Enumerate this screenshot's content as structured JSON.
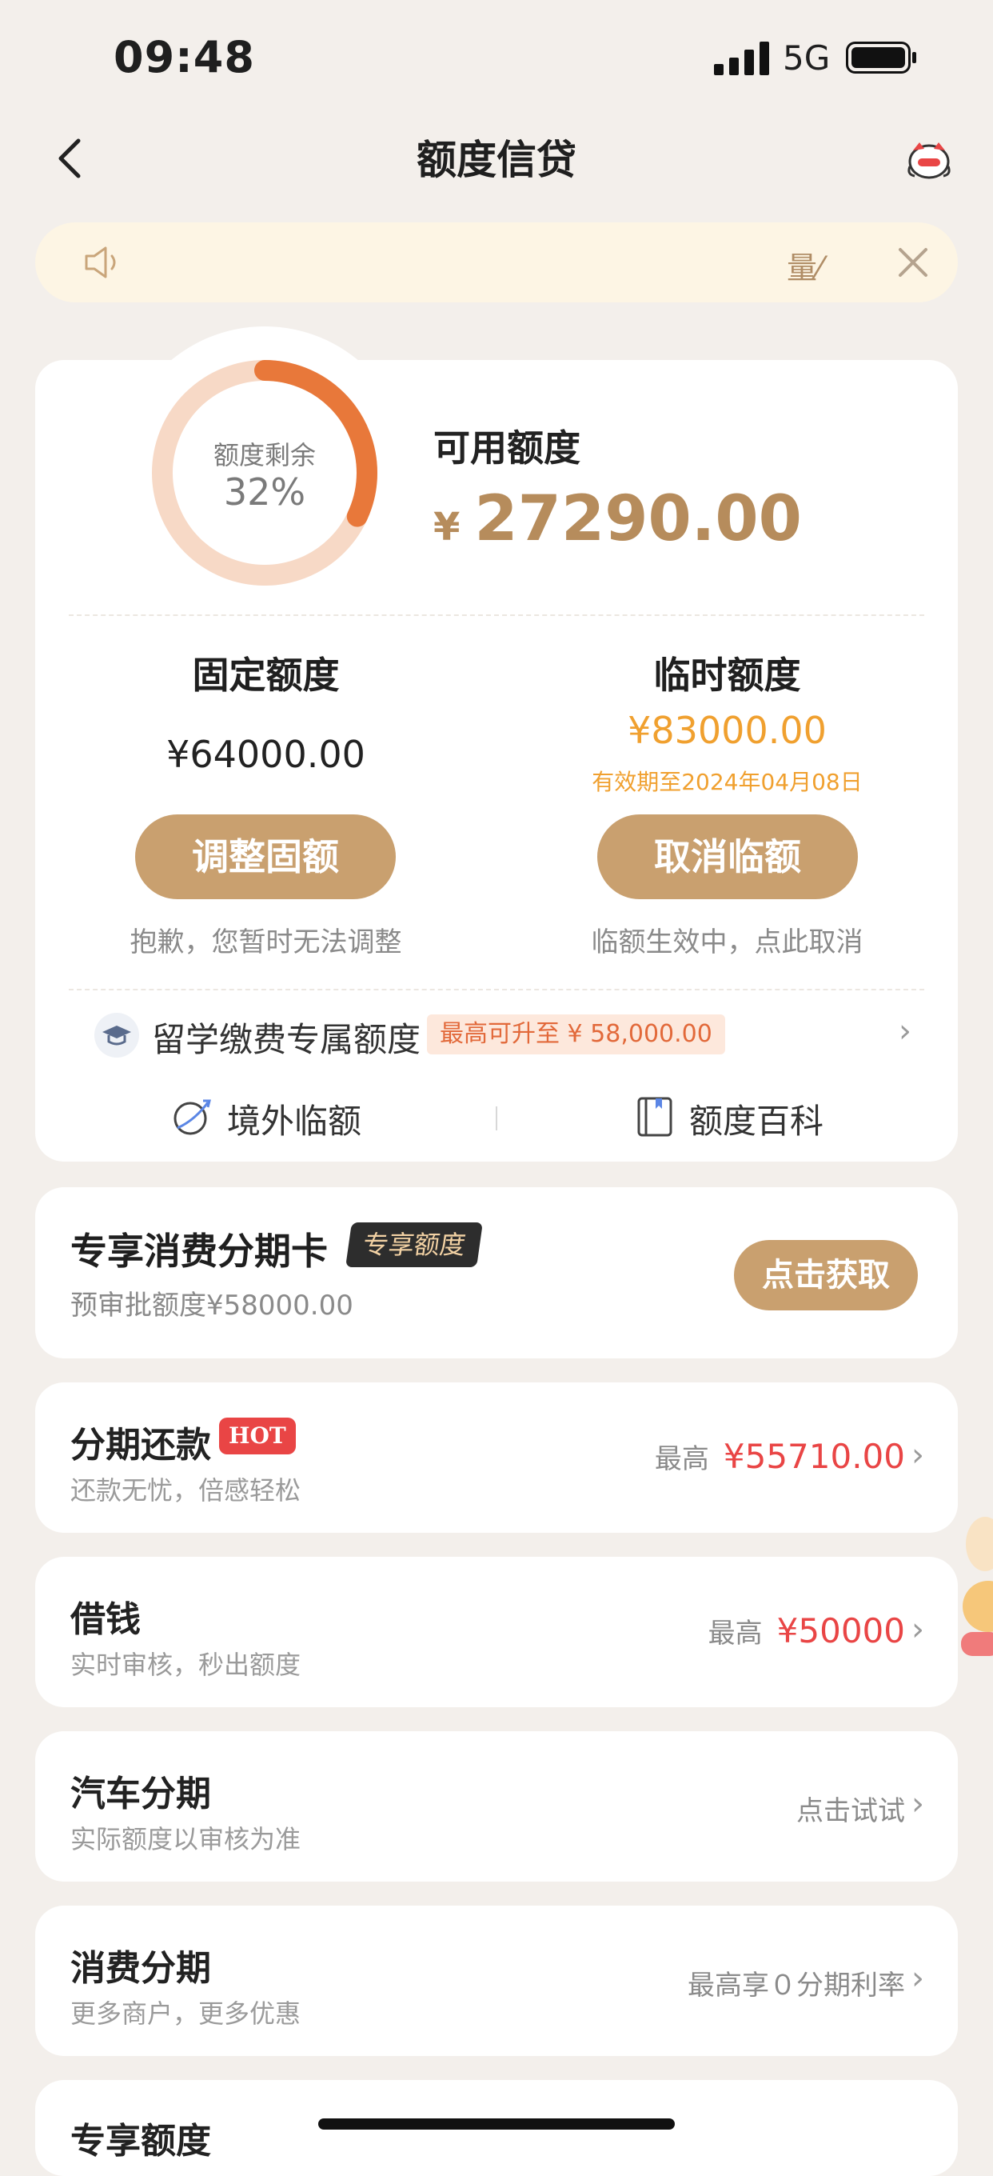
{
  "status": {
    "time": "09:48",
    "network": "5G"
  },
  "nav": {
    "title": "额度信贷"
  },
  "notice": {
    "text": "量⁄"
  },
  "credit": {
    "ring_label": "额度剩余",
    "ring_percent": "32%",
    "ring_fraction": 0.32,
    "available_label": "可用额度",
    "currency": "¥",
    "available_amount": "27290.00",
    "fixed": {
      "title": "固定额度",
      "amount": "¥64000.00",
      "button": "调整固额",
      "note": "抱歉，您暂时无法调整"
    },
    "temp": {
      "title": "临时额度",
      "amount": "¥83000.00",
      "valid": "有效期至2024年04月08日",
      "button": "取消临额",
      "note": "临额生效中，点此取消"
    },
    "study": {
      "title": "留学缴费专属额度",
      "badge": "最高可升至 ¥ 58,000.00"
    },
    "quick": [
      {
        "label": "境外临额",
        "icon": "globe-plane-icon"
      },
      {
        "label": "额度百科",
        "icon": "book-icon"
      }
    ]
  },
  "exclusive": {
    "title": "专享消费分期卡",
    "badge": "专享额度",
    "sub": "预审批额度¥58000.00",
    "button": "点击获取"
  },
  "list": [
    {
      "title": "分期还款",
      "tag": "HOT",
      "sub": "还款无忧，倍感轻松",
      "right_label": "最高",
      "right_value": "¥55710.00"
    },
    {
      "title": "借钱",
      "sub": "实时审核，秒出额度",
      "right_label": "最高",
      "right_value": "¥50000"
    },
    {
      "title": "汽车分期",
      "sub": "实际额度以审核为准",
      "right_label": "点击试试"
    },
    {
      "title": "消费分期",
      "sub": "更多商户，更多优惠",
      "right_label": "最高享０分期利率"
    },
    {
      "title": "专享额度"
    }
  ],
  "colors": {
    "accent": "#c9a06f",
    "amount_gold": "#b68c5c",
    "temp_orange": "#f0a02f",
    "hot_red": "#e94545",
    "ring": "#e8783a",
    "ring_track": "#f7d9c6"
  }
}
